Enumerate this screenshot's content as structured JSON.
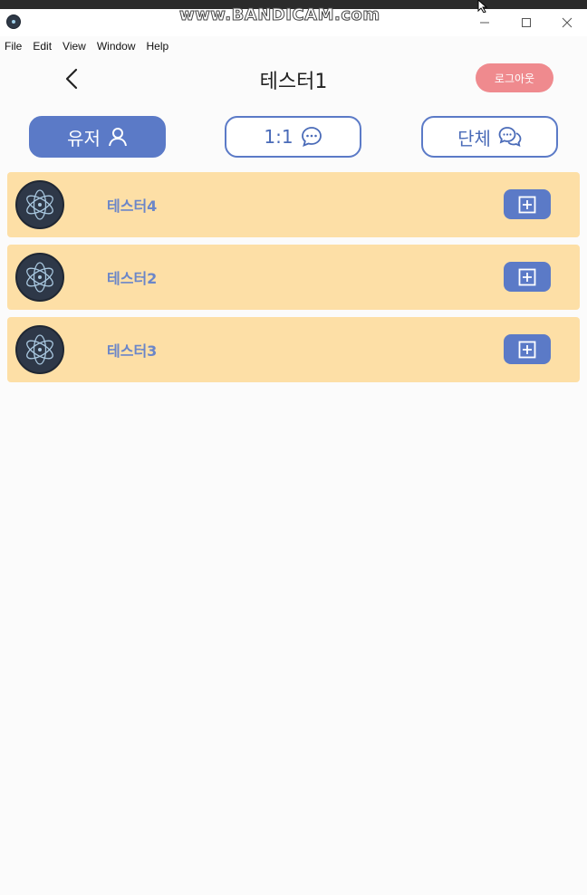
{
  "watermark": "www.BANDICAM.com",
  "menu": {
    "items": [
      "File",
      "Edit",
      "View",
      "Window",
      "Help"
    ]
  },
  "header": {
    "title": "테스터1",
    "logout_label": "로그아웃"
  },
  "tabs": [
    {
      "label": "유저",
      "icon": "user-icon",
      "active": true
    },
    {
      "label": "1:1",
      "icon": "chat-bubble-icon",
      "active": false
    },
    {
      "label": "단체",
      "icon": "group-chat-icon",
      "active": false
    }
  ],
  "users": [
    {
      "name": "테스터4"
    },
    {
      "name": "테스터2"
    },
    {
      "name": "테스터3"
    }
  ],
  "colors": {
    "accent": "#5b7ac7",
    "row_bg": "#fddfa6",
    "logout": "#ef8a8e",
    "name_text": "#6b86c8"
  }
}
